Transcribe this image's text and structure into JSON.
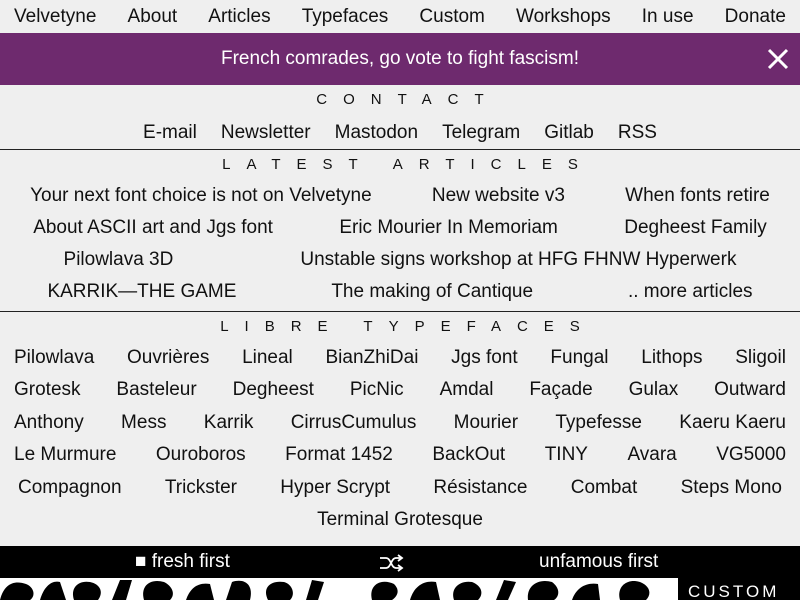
{
  "nav": {
    "items": [
      "Velvetyne",
      "About",
      "Articles",
      "Typefaces",
      "Custom",
      "Workshops",
      "In use",
      "Donate"
    ]
  },
  "banner": {
    "text": "French comrades, go vote to fight fascism!",
    "close_icon": "close-icon",
    "background": "#6e2a6e"
  },
  "contact": {
    "title": "Contact",
    "links": [
      "E-mail",
      "Newsletter",
      "Mastodon",
      "Telegram",
      "Gitlab",
      "RSS"
    ]
  },
  "articles": {
    "title": "Latest articles",
    "rows": [
      [
        "Your next font choice is not on Velvetyne",
        "New website v3",
        "When fonts retire"
      ],
      [
        "About ASCII art and Jgs font",
        "Eric Mourier In Memoriam",
        "Degheest Family"
      ],
      [
        "Pilowlava 3D",
        "Unstable signs workshop at HFG FHNW Hyperwerk"
      ],
      [
        "KARRIK—THE GAME",
        "The making of Cantique",
        ".. more articles"
      ]
    ]
  },
  "typefaces": {
    "title": "Libre typefaces",
    "rows": [
      [
        "Pilowlava",
        "Ouvrières",
        "Lineal",
        "BianZhiDai",
        "Jgs font",
        "Fungal",
        "Lithops",
        "Sligoil"
      ],
      [
        "Grotesk",
        "Basteleur",
        "Degheest",
        "PicNic",
        "Amdal",
        "Façade",
        "Gulax",
        "Outward"
      ],
      [
        "Anthony",
        "Mess",
        "Karrik",
        "CirrusCumulus",
        "Mourier",
        "Typefesse",
        "Kaeru Kaeru"
      ],
      [
        "Le Murmure",
        "Ouroboros",
        "Format 1452",
        "BackOut",
        "TINY",
        "Avara",
        "VG5000"
      ],
      [
        "Compagnon",
        "Trickster",
        "Hyper Scrypt",
        "Résistance",
        "Combat",
        "Steps Mono"
      ],
      [
        "Terminal Grotesque"
      ]
    ]
  },
  "footer": {
    "fresh_first": "■ fresh first",
    "shuffle_icon": "shuffle-icon",
    "unfamous_first": "unfamous first"
  },
  "specimen": {
    "custom_label": "CUSTOM"
  }
}
